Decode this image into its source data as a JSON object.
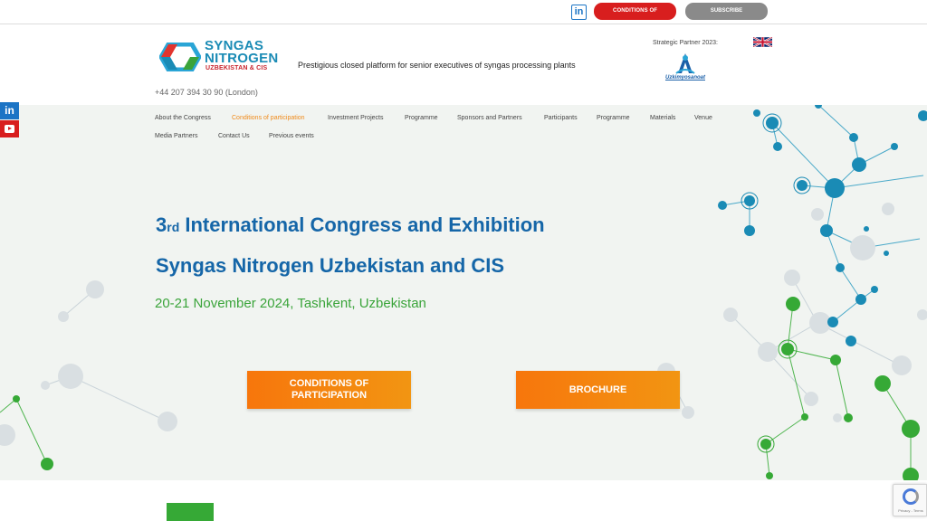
{
  "topbar": {
    "linkedin_icon": "linkedin-icon",
    "conditions_label": "CONDITIONS OF PARTICIPATION",
    "subscribe_label": "SUBSCRIBE"
  },
  "header": {
    "logo_line1": "SYNGAS",
    "logo_line2": "NITROGEN",
    "logo_line3": "UZBEKISTAN & CIS",
    "tagline": "Prestigious closed platform for senior executives of syngas processing plants",
    "partner_label": "Strategic Partner 2023:",
    "partner_name": "Uzkimyosanoat",
    "phone": "+44 207 394 30 90 (London)",
    "language_flag": "uk-flag-icon"
  },
  "social": {
    "linkedin": "linkedin-icon",
    "youtube": "youtube-icon"
  },
  "nav": {
    "row1": [
      "About the Congress",
      "Conditions of participation",
      "Investment Projects",
      "Programme",
      "Sponsors and Partners",
      "Participants",
      "Programme",
      "Materials",
      "Venue"
    ],
    "row2": [
      "Media Partners",
      "Contact Us",
      "Previous events"
    ],
    "active_index": 1
  },
  "hero": {
    "title_num": "3",
    "title_sup": "rd",
    "title_rest": " International Congress and Exhibition",
    "subtitle": "Syngas Nitrogen Uzbekistan and CIS",
    "date": "20-21 November 2024, Tashkent, Uzbekistan",
    "cta_conditions_line1": "CONDITIONS OF",
    "cta_conditions_line2": "PARTICIPATION",
    "cta_brochure": "BROCHURE"
  },
  "recaptcha": {
    "text": "Privacy - Terms"
  },
  "colors": {
    "accent_blue": "#1566a8",
    "accent_green": "#3aa43a",
    "accent_orange": "#f7760c",
    "red": "#d81e1e"
  }
}
